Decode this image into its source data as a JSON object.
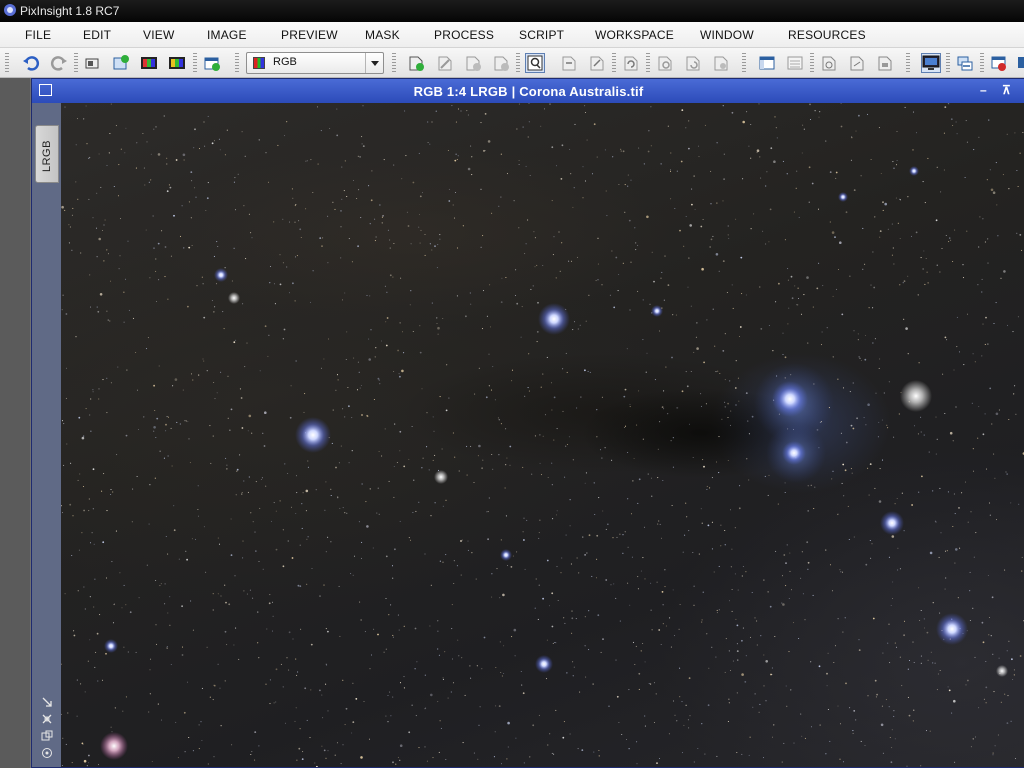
{
  "window": {
    "title": "PixInsight 1.8 RC7"
  },
  "menu": [
    "FILE",
    "EDIT",
    "VIEW",
    "IMAGE",
    "PREVIEW",
    "MASK",
    "PROCESS",
    "SCRIPT",
    "WORKSPACE",
    "WINDOW",
    "RESOURCES"
  ],
  "toolbar": {
    "color_mode": "RGB"
  },
  "image_window": {
    "title": "RGB 1:4 LRGB | Corona Australis.tif",
    "mask_tab_label": "LRGB",
    "minimize_glyph": "–",
    "maximize_glyph": "⊼"
  },
  "colors": {
    "active_window": "#2c4bb9",
    "accent": "#4a6bd6"
  }
}
